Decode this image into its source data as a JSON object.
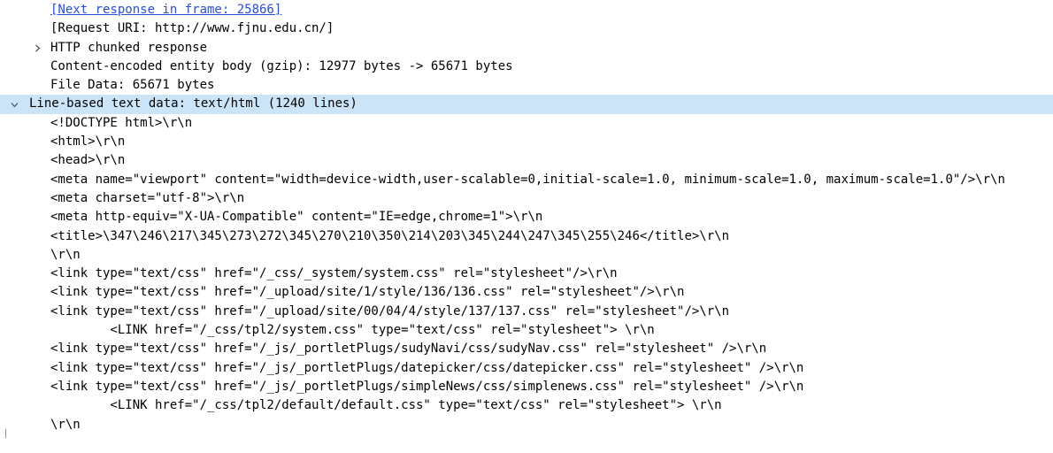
{
  "packet_details": {
    "rows": [
      {
        "text": "[Next response in frame: 25866]",
        "kind": "link"
      },
      {
        "text": "[Request URI: http://www.fjnu.edu.cn/]"
      },
      {
        "text": "HTTP chunked response",
        "toggle": "collapsed"
      },
      {
        "text": "Content-encoded entity body (gzip): 12977 bytes -> 65671 bytes"
      },
      {
        "text": "File Data: 65671 bytes"
      },
      {
        "text": "Line-based text data: text/html (1240 lines)",
        "toggle": "expanded",
        "selected": true
      }
    ],
    "lines": [
      "<!DOCTYPE html>\\r\\n",
      "<html>\\r\\n",
      "<head>\\r\\n",
      "<meta name=\"viewport\" content=\"width=device-width,user-scalable=0,initial-scale=1.0, minimum-scale=1.0, maximum-scale=1.0\"/>\\r\\n",
      "<meta charset=\"utf-8\">\\r\\n",
      "<meta http-equiv=\"X-UA-Compatible\" content=\"IE=edge,chrome=1\">\\r\\n",
      "<title>\\347\\246\\217\\345\\273\\272\\345\\270\\210\\350\\214\\203\\345\\244\\247\\345\\255\\246</title>\\r\\n",
      "\\r\\n",
      "<link type=\"text/css\" href=\"/_css/_system/system.css\" rel=\"stylesheet\"/>\\r\\n",
      "<link type=\"text/css\" href=\"/_upload/site/1/style/136/136.css\" rel=\"stylesheet\"/>\\r\\n",
      "<link type=\"text/css\" href=\"/_upload/site/00/04/4/style/137/137.css\" rel=\"stylesheet\"/>\\r\\n",
      "        <LINK href=\"/_css/tpl2/system.css\" type=\"text/css\" rel=\"stylesheet\"> \\r\\n",
      "<link type=\"text/css\" href=\"/_js/_portletPlugs/sudyNavi/css/sudyNav.css\" rel=\"stylesheet\" />\\r\\n",
      "<link type=\"text/css\" href=\"/_js/_portletPlugs/datepicker/css/datepicker.css\" rel=\"stylesheet\" />\\r\\n",
      "<link type=\"text/css\" href=\"/_js/_portletPlugs/simpleNews/css/simplenews.css\" rel=\"stylesheet\" />\\r\\n",
      "        <LINK href=\"/_css/tpl2/default/default.css\" type=\"text/css\" rel=\"stylesheet\"> \\r\\n",
      "\\r\\n"
    ],
    "colors": {
      "selected_row": "#cce4f7",
      "link": "#2a4fd6",
      "toggle": "#505050"
    },
    "icons": {
      "collapsed": "chevron-right-icon",
      "expanded": "chevron-down-icon"
    }
  }
}
